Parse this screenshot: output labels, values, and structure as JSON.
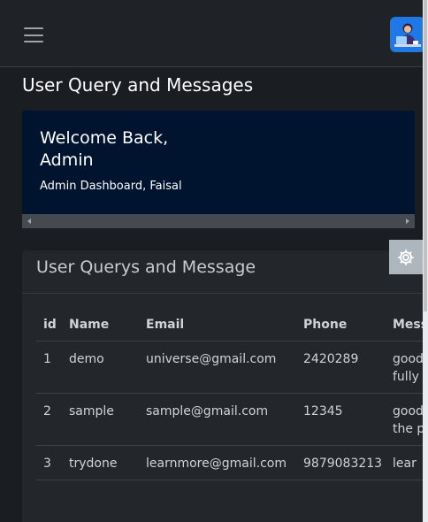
{
  "header": {
    "menu_icon": "hamburger-menu-icon",
    "avatar_icon": "user-avatar-icon"
  },
  "page": {
    "title": "User Query and Messages"
  },
  "welcome": {
    "title_line1": "Welcome Back,",
    "title_line2": "Admin",
    "subtitle": "Admin Dashboard, Faisal"
  },
  "settings": {
    "icon": "gear-icon"
  },
  "card": {
    "title": "User Querys and Message"
  },
  "table": {
    "columns": [
      "id",
      "Name",
      "Email",
      "Phone",
      "Message"
    ],
    "rows": [
      {
        "id": "1",
        "name": "demo",
        "email": "universe@gmail.com",
        "phone": "2420289",
        "message": "good conn fully"
      },
      {
        "id": "2",
        "name": "sample",
        "email": "sample@gmail.com",
        "phone": "12345",
        "message": "good conn the part"
      },
      {
        "id": "3",
        "name": "trydone",
        "email": "learnmore@gmail.com",
        "phone": "9879083213",
        "message": "lear"
      }
    ]
  },
  "colors": {
    "background": "#1a1d21",
    "topbar": "#1f2227",
    "welcome_card": "#001430",
    "query_card": "#23272c",
    "settings_button": "#adb5bd"
  }
}
